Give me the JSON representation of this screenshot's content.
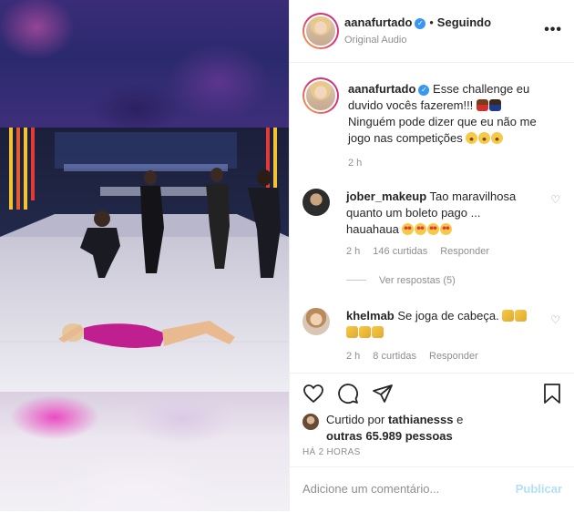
{
  "post": {
    "author": "aanafurtado",
    "follow_label": "Seguindo",
    "audio": "Original Audio",
    "more_label": "•••"
  },
  "caption": {
    "username": "aanafurtado",
    "text_part1": "Esse challenge eu duvido vocês fazerem!!!",
    "text_part2": "Ninguém pode dizer que eu não me jogo nas competições",
    "time": "2 h"
  },
  "comments": [
    {
      "username": "jober_makeup",
      "text": "Tao maravilhosa quanto um boleto pago ... hauahaua",
      "time": "2 h",
      "likes": "146 curtidas",
      "reply": "Responder",
      "view_replies": "Ver respostas (5)"
    },
    {
      "username": "khelmab",
      "text": "Se joga de cabeça.",
      "time": "2 h",
      "likes": "8 curtidas",
      "reply": "Responder"
    }
  ],
  "likes": {
    "prefix": "Curtido por",
    "user": "tathianesss",
    "conjunction": "e",
    "others": "outras 65.989 pessoas"
  },
  "time_ago": "HÁ 2 HORAS",
  "comment_box": {
    "placeholder": "Adicione um comentário...",
    "publish_label": "Publicar"
  },
  "icons": {
    "like": "heart-icon",
    "comment": "comment-icon",
    "share": "share-icon",
    "save": "bookmark-icon",
    "verified": "verified-badge-icon"
  },
  "colors": {
    "verified": "#3897f0",
    "publish": "#b2dffc",
    "muted": "#8e8e8e"
  }
}
